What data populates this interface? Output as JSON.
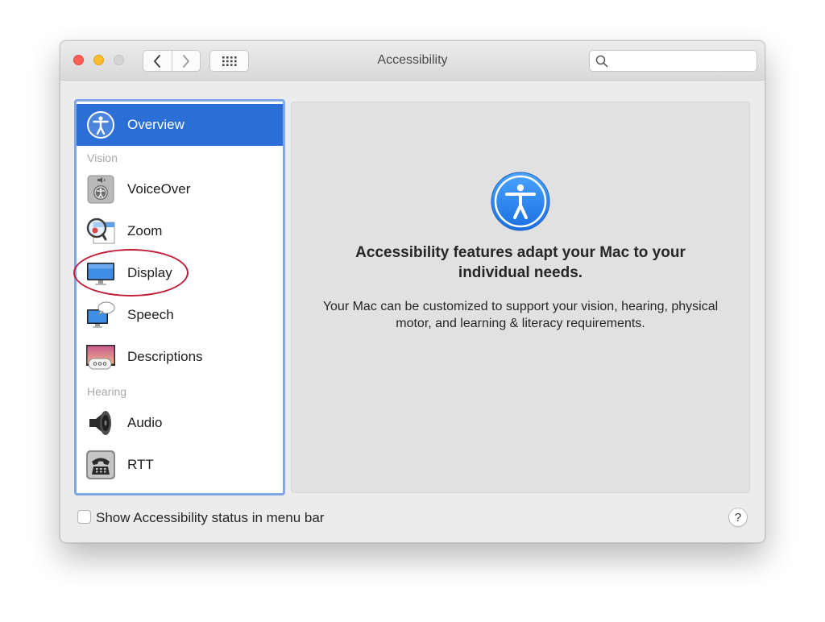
{
  "window": {
    "title": "Accessibility",
    "search_placeholder": "",
    "search_icon": "magnifier-icon"
  },
  "sidebar": {
    "selected": "Overview",
    "overview": {
      "label": "Overview",
      "icon": "accessibility-person-icon"
    },
    "sections": {
      "vision": "Vision",
      "hearing": "Hearing"
    },
    "items": [
      {
        "label": "VoiceOver",
        "icon": "voiceover-icon"
      },
      {
        "label": "Zoom",
        "icon": "zoom-magnifier-icon"
      },
      {
        "label": "Display",
        "icon": "display-monitor-icon"
      },
      {
        "label": "Speech",
        "icon": "speech-bubble-icon"
      },
      {
        "label": "Descriptions",
        "icon": "descriptions-icon"
      },
      {
        "label": "Audio",
        "icon": "speaker-icon"
      },
      {
        "label": "RTT",
        "icon": "telephone-icon"
      }
    ]
  },
  "main": {
    "headline": "Accessibility features adapt your Mac to your individual needs.",
    "description": "Your Mac can be customized to support your vision, hearing, physical motor, and learning & literacy requirements."
  },
  "footer": {
    "checkbox_label": "Show Accessibility status in menu bar",
    "checkbox_checked": false,
    "help_label": "?"
  },
  "colors": {
    "selection": "#2b6fd6",
    "sidebar_border": "#7fa7e8",
    "annotation": "#c01d3a"
  }
}
